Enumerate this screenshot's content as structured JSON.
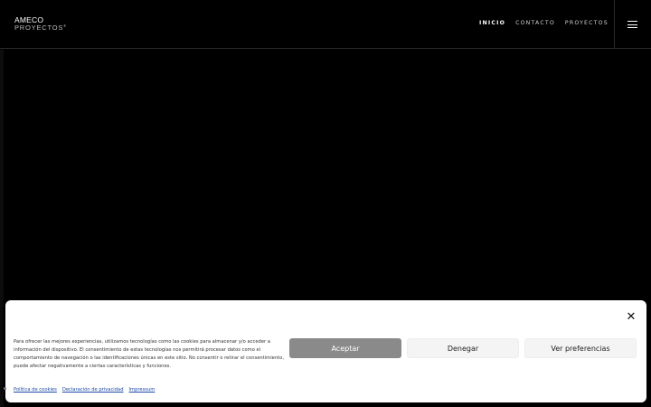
{
  "header": {
    "logo_line1": "AMECO",
    "logo_line2": "PROYECTOS",
    "logo_mark": "®",
    "nav": [
      {
        "label": "INICIO",
        "active": true
      },
      {
        "label": "CONTACTO",
        "active": false
      },
      {
        "label": "PROYECTOS",
        "active": false
      }
    ],
    "menu_icon": "hamburger-icon"
  },
  "cookie_banner": {
    "close_icon": "close-icon",
    "text": "Para ofrecer las mejores experiencias, utilizamos tecnologías como las cookies para almacenar y/o acceder a información del dispositivo. El consentimiento de estas tecnologías nos permitirá procesar datos como el comportamiento de navegación o las identificaciones únicas en este sitio. No consentir o retirar el consentimiento, puede afectar negativamente a ciertas características y funciones.",
    "buttons": {
      "accept": "Aceptar",
      "deny": "Denegar",
      "preferences": "Ver preferencias"
    },
    "links": {
      "cookie_policy": "Política de cookies",
      "privacy_statement": "Declaración de privacidad",
      "impressum": "Impressum"
    }
  },
  "colors": {
    "background": "#000000",
    "accept_button": "#8a8a8a",
    "link": "#1a4aa8"
  }
}
